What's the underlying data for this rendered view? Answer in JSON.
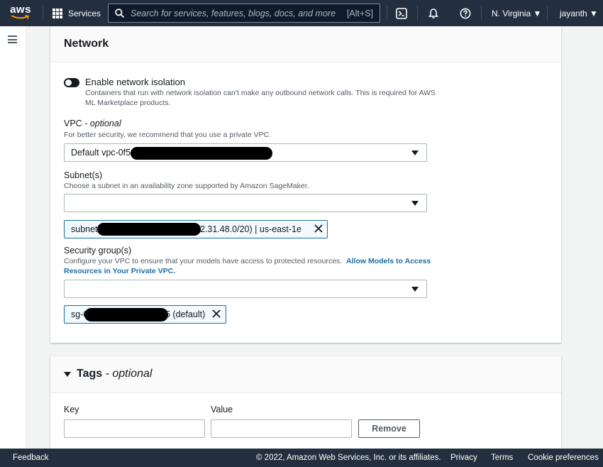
{
  "topnav": {
    "logo_text": "aws",
    "services_label": "Services",
    "search_placeholder": "Search for services, features, blogs, docs, and more",
    "search_shortcut": "[Alt+S]",
    "region": "N. Virginia ▼",
    "user": "jayanth ▼",
    "icons": [
      "cloudshell-icon",
      "bell-icon",
      "help-icon"
    ]
  },
  "network": {
    "title": "Network",
    "isolation": {
      "label": "Enable network isolation",
      "description": "Containers that run with network isolation can't make any outbound network calls. This is required for AWS ML Marketplace products.",
      "enabled": false
    },
    "vpc": {
      "label": "VPC",
      "optional": " - optional",
      "description": "For better security, we recommend that you use a private VPC.",
      "value": "Default vpc-0f5"
    },
    "subnets": {
      "label": "Subnet(s)",
      "description": "Choose a subnet in an availability zone supported by Amazon SageMaker.",
      "value": "",
      "token_prefix": "subnet",
      "token_suffix": "2.31.48.0/20) | us-east-1e"
    },
    "security_groups": {
      "label": "Security group(s)",
      "description": "Configure your VPC to ensure that your models have access to protected resources.",
      "link": "Allow Models to Access Resources in Your Private VPC.",
      "value": "",
      "token_prefix": "sg-0",
      "token_suffix": "5 (default)"
    }
  },
  "tags": {
    "title": "Tags",
    "optional": " - optional",
    "key_label": "Key",
    "value_label": "Value",
    "key_value": "",
    "value_value": "",
    "remove_label": "Remove"
  },
  "footer": {
    "feedback": "Feedback",
    "copyright": "© 2022, Amazon Web Services, Inc. or its affiliates.",
    "privacy": "Privacy",
    "terms": "Terms",
    "cookies": "Cookie preferences"
  },
  "colors": {
    "nav_bg": "#232f3e",
    "link": "#1d6ea7",
    "token_border": "#1d6ea7",
    "token_bg": "#f1faff"
  }
}
